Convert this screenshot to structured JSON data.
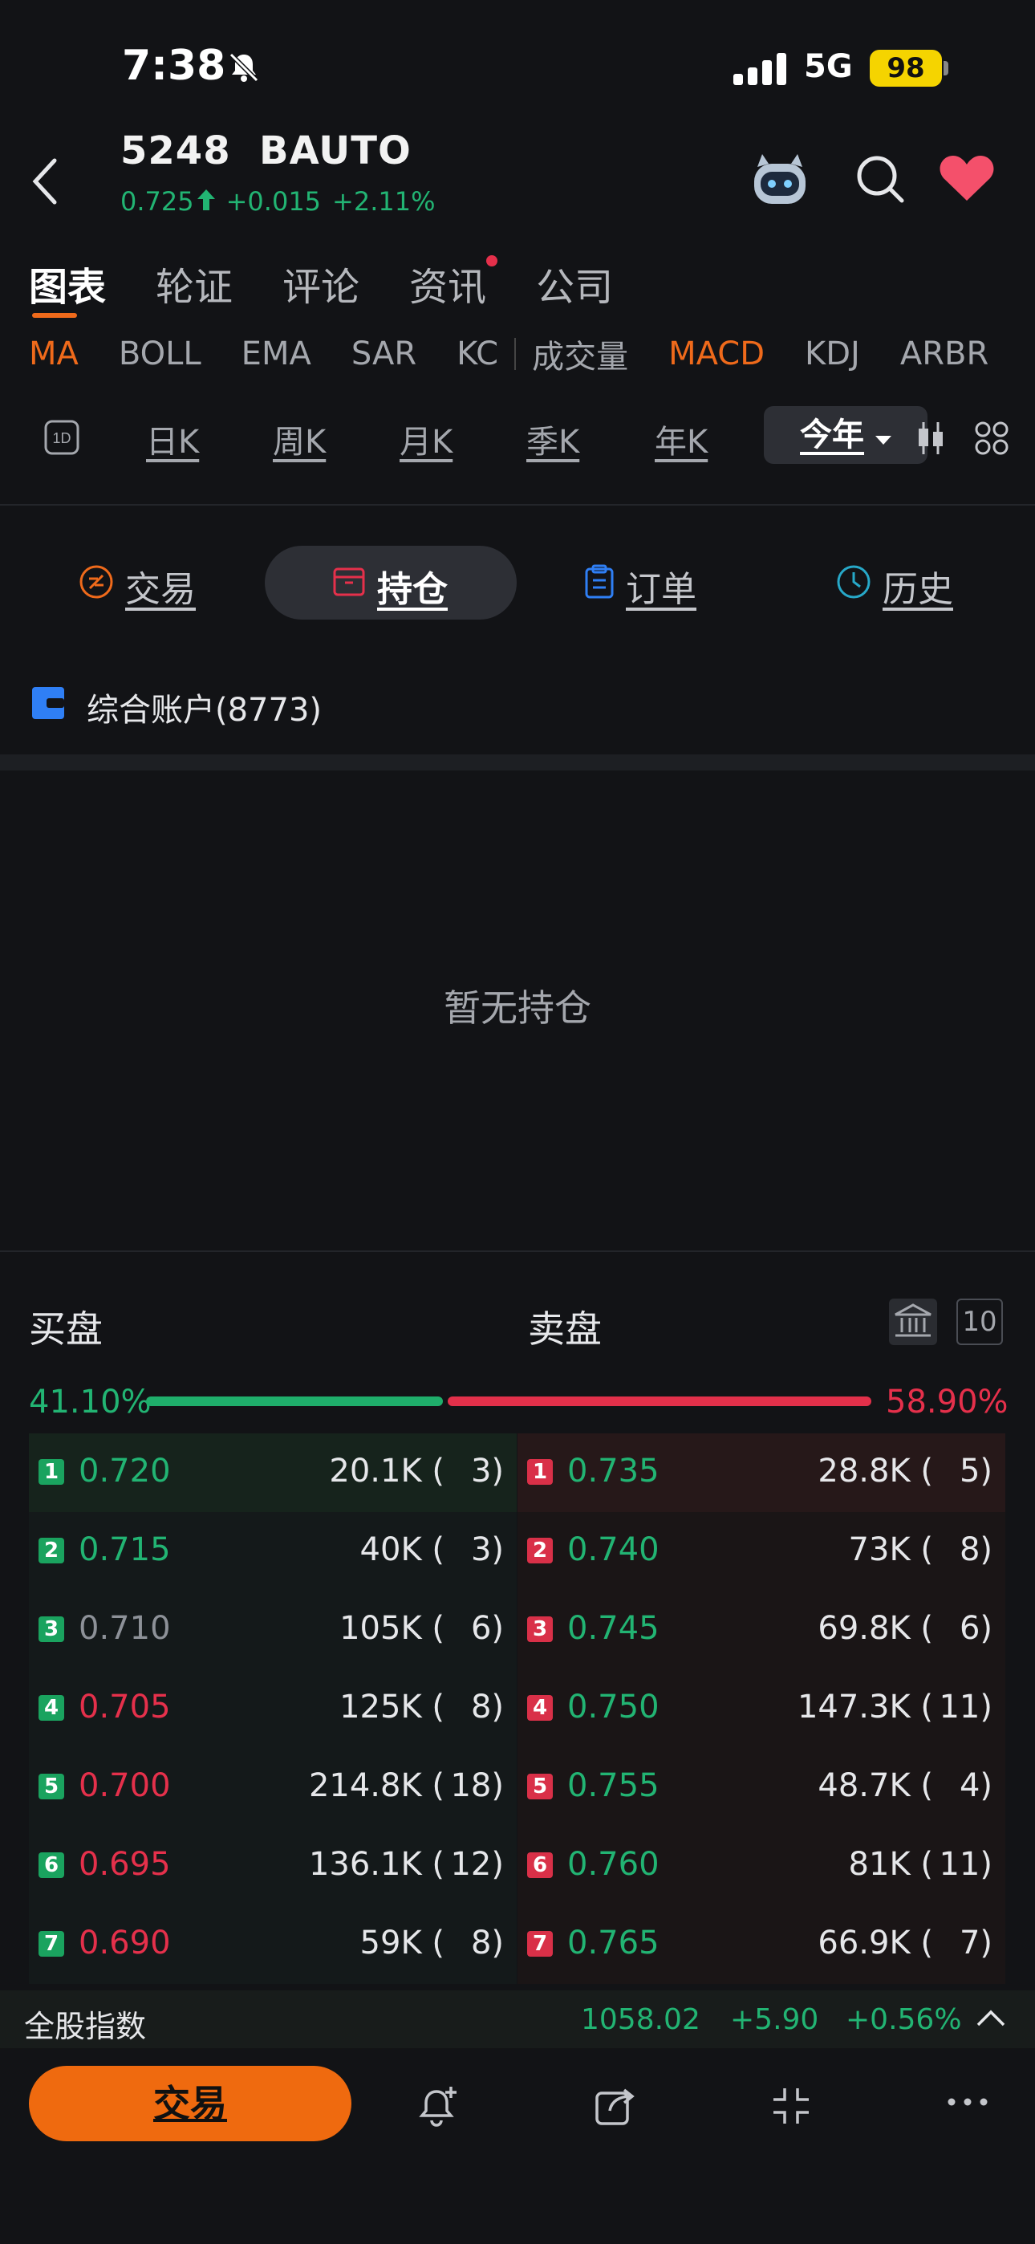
{
  "status": {
    "time": "7:38",
    "network": "5G",
    "battery": "98"
  },
  "header": {
    "code": "5248",
    "name": "BAUTO",
    "price": "0.725",
    "change": "+0.015",
    "change_pct": "+2.11%"
  },
  "tabs": [
    "图表",
    "轮证",
    "评论",
    "资讯",
    "公司"
  ],
  "indicators": [
    "MA",
    "BOLL",
    "EMA",
    "SAR",
    "KC",
    "成交量",
    "MACD",
    "KDJ",
    "ARBR"
  ],
  "periods": [
    "日K",
    "周K",
    "月K",
    "季K",
    "年K"
  ],
  "period_selected": "今年",
  "trade_tabs": {
    "trade": "交易",
    "position": "持仓",
    "orders": "订单",
    "history": "历史"
  },
  "account": "综合账户(8773)",
  "empty_text": "暂无持仓",
  "orderbook": {
    "bid_label": "买盘",
    "ask_label": "卖盘",
    "depth": "10",
    "bid_pct": "41.10%",
    "ask_pct": "58.90%",
    "bids": [
      {
        "idx": "1",
        "price": "0.720",
        "vol": "20.1K (",
        "cnt": "3)"
      },
      {
        "idx": "2",
        "price": "0.715",
        "vol": "40K (",
        "cnt": "3)"
      },
      {
        "idx": "3",
        "price": "0.710",
        "vol": "105K (",
        "cnt": "6)"
      },
      {
        "idx": "4",
        "price": "0.705",
        "vol": "125K (",
        "cnt": "8)"
      },
      {
        "idx": "5",
        "price": "0.700",
        "vol": "214.8K (",
        "cnt": "18)"
      },
      {
        "idx": "6",
        "price": "0.695",
        "vol": "136.1K (",
        "cnt": "12)"
      },
      {
        "idx": "7",
        "price": "0.690",
        "vol": "59K (",
        "cnt": "8)"
      }
    ],
    "asks": [
      {
        "idx": "1",
        "price": "0.735",
        "vol": "28.8K (",
        "cnt": "5)"
      },
      {
        "idx": "2",
        "price": "0.740",
        "vol": "73K (",
        "cnt": "8)"
      },
      {
        "idx": "3",
        "price": "0.745",
        "vol": "69.8K (",
        "cnt": "6)"
      },
      {
        "idx": "4",
        "price": "0.750",
        "vol": "147.3K (",
        "cnt": "11)"
      },
      {
        "idx": "5",
        "price": "0.755",
        "vol": "48.7K (",
        "cnt": "4)"
      },
      {
        "idx": "6",
        "price": "0.760",
        "vol": "81K (",
        "cnt": "11)"
      },
      {
        "idx": "7",
        "price": "0.765",
        "vol": "66.9K (",
        "cnt": "7)"
      }
    ]
  },
  "index_bar": {
    "name": "全股指数",
    "value": "1058.02",
    "change": "+5.90",
    "change_pct": "+0.56%"
  },
  "bottom": {
    "trade_label": "交易"
  },
  "colors": {
    "accent": "#ef6a0f",
    "up": "#22b473",
    "down": "#e5304b"
  }
}
